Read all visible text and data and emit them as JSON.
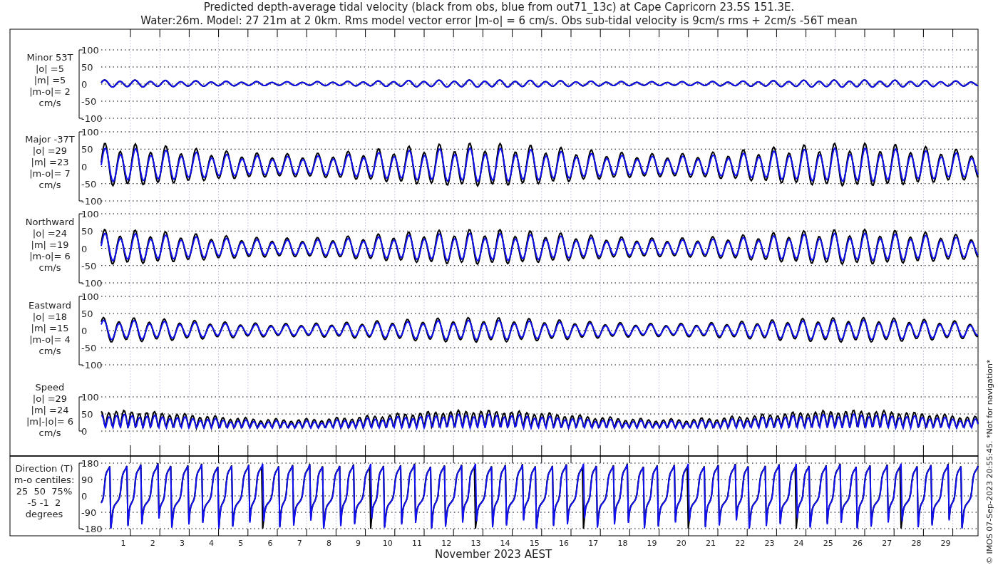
{
  "title_lines": [
    "Predicted depth-average tidal velocity (black from obs, blue from out71_13c) at Cape Capricorn 23.5S 151.3E.",
    "Water:26m. Model: 27 21m at 2 0km. Rms model vector error |m-o| = 6 cm/s. Obs sub-tidal velocity is 9cm/s rms + 2cm/s -56T mean"
  ],
  "panels": [
    {
      "kind": "velocity",
      "label_lines": [
        "Minor 53T",
        "|o| =5",
        "|m| =5",
        "|m-o|= 2",
        "cm/s"
      ],
      "yticks": [
        "100",
        "50",
        "0",
        "-50",
        "-100"
      ]
    },
    {
      "kind": "velocity",
      "label_lines": [
        "Major -37T",
        "|o| =29",
        "|m| =23",
        "|m-o|= 7",
        "cm/s"
      ],
      "yticks": [
        "100",
        "50",
        "0",
        "-50",
        "-100"
      ]
    },
    {
      "kind": "velocity",
      "label_lines": [
        "Northward",
        "|o| =24",
        "|m| =19",
        "|m-o|= 6",
        "cm/s"
      ],
      "yticks": [
        "100",
        "50",
        "0",
        "-50",
        "-100"
      ]
    },
    {
      "kind": "velocity",
      "label_lines": [
        "Eastward",
        "|o| =18",
        "|m| =15",
        "|m-o|= 4",
        "cm/s"
      ],
      "yticks": [
        "100",
        "50",
        "0",
        "-50",
        "-100"
      ]
    },
    {
      "kind": "speed",
      "label_lines": [
        "Speed",
        "|o| =29",
        "|m| =24",
        "|m|-|o|= 6",
        "cm/s"
      ],
      "yticks": [
        "100",
        "50",
        "0"
      ]
    },
    {
      "kind": "direction",
      "label_lines": [
        "Direction (T)",
        "m-o centiles:",
        "25  50  75%",
        "-5 -1  2",
        "degrees"
      ],
      "yticks": [
        "180",
        "90",
        "0",
        "-90",
        "-180"
      ]
    }
  ],
  "xaxis": {
    "ticks": [
      "1",
      "2",
      "3",
      "4",
      "5",
      "6",
      "7",
      "8",
      "9",
      "10",
      "11",
      "12",
      "13",
      "14",
      "15",
      "16",
      "17",
      "18",
      "19",
      "20",
      "21",
      "22",
      "23",
      "24",
      "25",
      "26",
      "27",
      "28",
      "29"
    ],
    "label": "November 2023 AEST"
  },
  "credit": "© IMOS 07-Sep-2023 20:55:45. *Not for navigation*"
}
